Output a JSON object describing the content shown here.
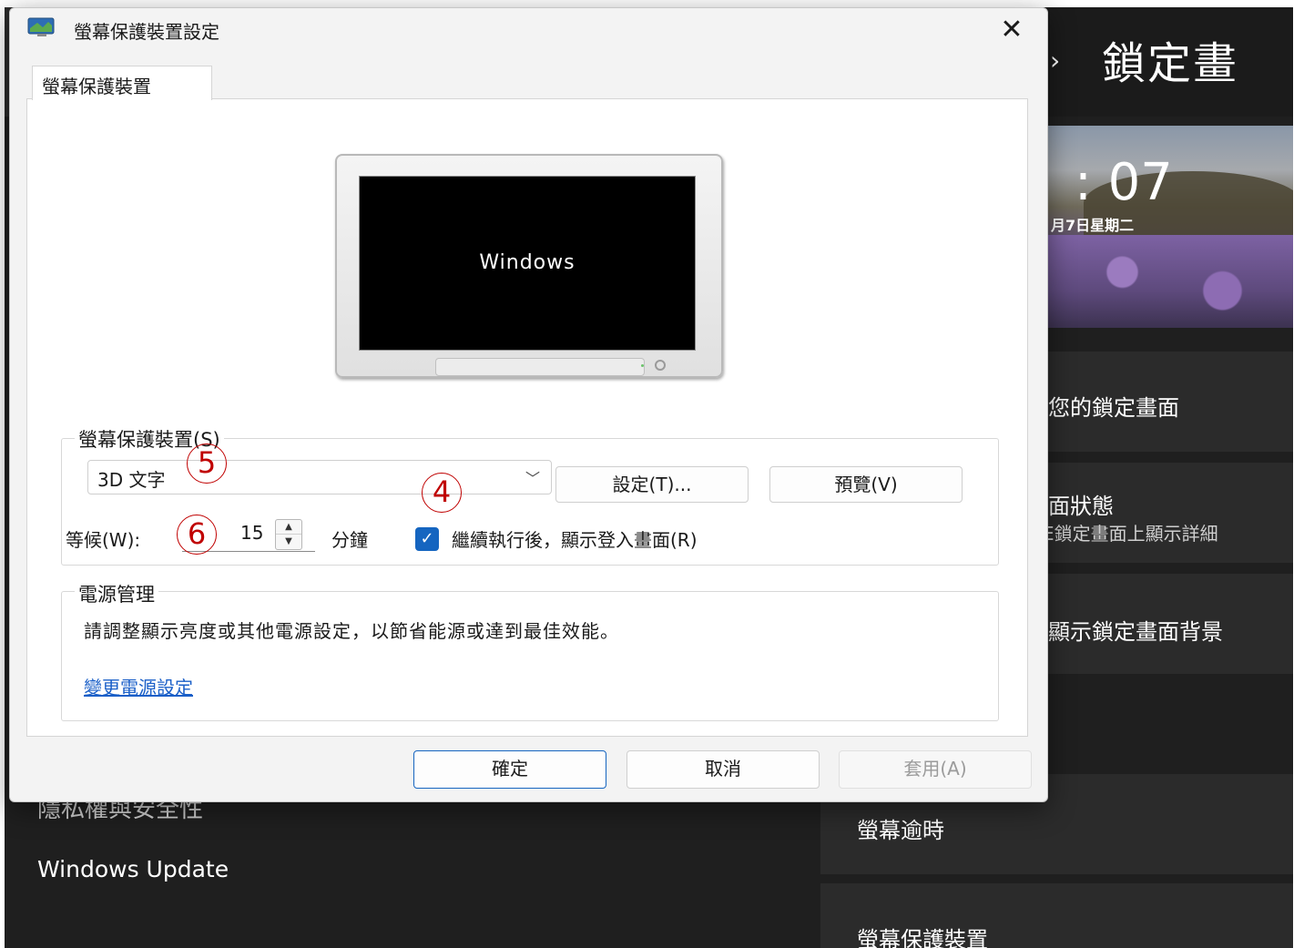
{
  "background_settings": {
    "page_heading": "鎖定畫",
    "breadcrumb_chevron": "›",
    "lock_preview": {
      "time": ": 07",
      "date": "月7日星期二"
    },
    "cards": [
      {
        "title": "您的鎖定畫面",
        "desc": ""
      },
      {
        "title": "面狀態",
        "desc": "E鎖定畫面上顯示詳細"
      },
      {
        "title": "顯示鎖定畫面背景",
        "desc": ""
      },
      {
        "title": "螢幕逾時",
        "desc": ""
      },
      {
        "title": "螢幕保護裝置",
        "desc": ""
      }
    ],
    "nav": {
      "privacy": "隱私權與安全性",
      "update": "Windows Update"
    }
  },
  "dialog": {
    "title": "螢幕保護裝置設定",
    "close_icon": "✕",
    "tab_label": "螢幕保護裝置",
    "monitor_preview_text": "Windows",
    "screensaver_group": {
      "legend": "螢幕保護裝置(S)",
      "selected_value": "3D 文字",
      "settings_button": "設定(T)...",
      "preview_button": "預覽(V)",
      "wait_label": "等候(W):",
      "wait_value": "15",
      "minutes_label": "分鐘",
      "resume_checkbox_checked": true,
      "resume_label": "繼續執行後，顯示登入畫面(R)"
    },
    "power_group": {
      "legend": "電源管理",
      "description": "請調整顯示亮度或其他電源設定，以節省能源或達到最佳效能。",
      "link": "變更電源設定"
    },
    "buttons": {
      "ok": "確定",
      "cancel": "取消",
      "apply": "套用(A)"
    }
  },
  "annotations": {
    "a4": "4",
    "a5": "5",
    "a6": "6"
  },
  "colors": {
    "accent": "#1565c0",
    "annotation": "#c00000",
    "link": "#1a5fc8",
    "settings_bg": "#1f1f1f"
  }
}
